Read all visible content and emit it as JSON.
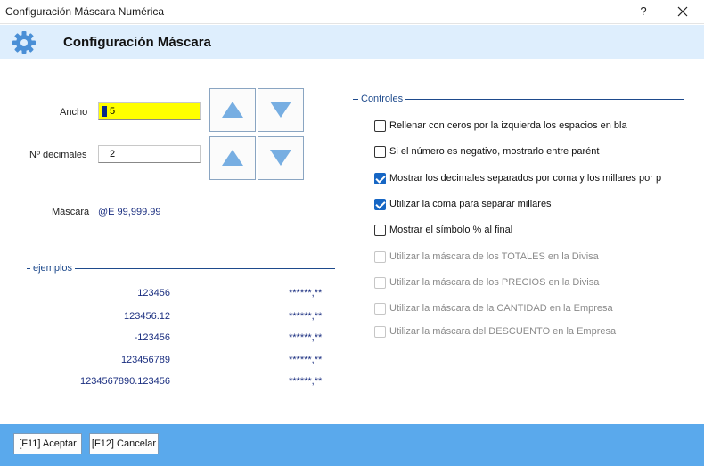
{
  "window": {
    "title": "Configuración Máscara Numérica",
    "help_glyph": "?",
    "close_glyph": "✕"
  },
  "header": {
    "icon": "gear-icon",
    "title": "Configuración Máscara"
  },
  "form": {
    "ancho_label": "Ancho",
    "ancho_value": "5",
    "decimales_label": "Nº decimales",
    "decimales_value": "2",
    "mascara_label": "Máscara",
    "mascara_value": "@E 99,999.99"
  },
  "ejemplos": {
    "title": "ejemplos",
    "rows": [
      {
        "number": "123456",
        "result": "******,**"
      },
      {
        "number": "123456.12",
        "result": "******,**"
      },
      {
        "number": "-123456",
        "result": "******,**"
      },
      {
        "number": "123456789",
        "result": "******,**"
      },
      {
        "number": "1234567890.123456",
        "result": "******,**"
      }
    ]
  },
  "controles": {
    "title": "Controles",
    "options": [
      {
        "label": "Rellenar con ceros por la izquierda los espacios en bla",
        "checked": false,
        "enabled": true
      },
      {
        "label": "Si el número es negativo, mostrarlo entre parént",
        "checked": false,
        "enabled": true
      },
      {
        "label": "Mostrar los decimales separados por coma y los millares por p",
        "checked": true,
        "enabled": true
      },
      {
        "label": "Utilizar la coma para separar millares",
        "checked": true,
        "enabled": true
      },
      {
        "label": "Mostrar el símbolo % al final",
        "checked": false,
        "enabled": true
      },
      {
        "label": "Utilizar la máscara de los TOTALES en la Divisa",
        "checked": false,
        "enabled": false
      },
      {
        "label": "Utilizar la máscara de los PRECIOS en la Divisa",
        "checked": false,
        "enabled": false
      },
      {
        "label": "Utilizar la máscara de la CANTIDAD en la Empresa",
        "checked": false,
        "enabled": false
      },
      {
        "label": "Utilizar la máscara del DESCUENTO en la Empresa",
        "checked": false,
        "enabled": false
      }
    ]
  },
  "footer": {
    "accept_label": "[F11] Aceptar",
    "cancel_label": "[F12] Cancelar"
  },
  "colors": {
    "header_bg": "#deeefd",
    "footer_bg": "#5aa9ec",
    "accent": "#1666c4",
    "arrow": "#77aee2",
    "highlight_field": "#ffff00"
  }
}
